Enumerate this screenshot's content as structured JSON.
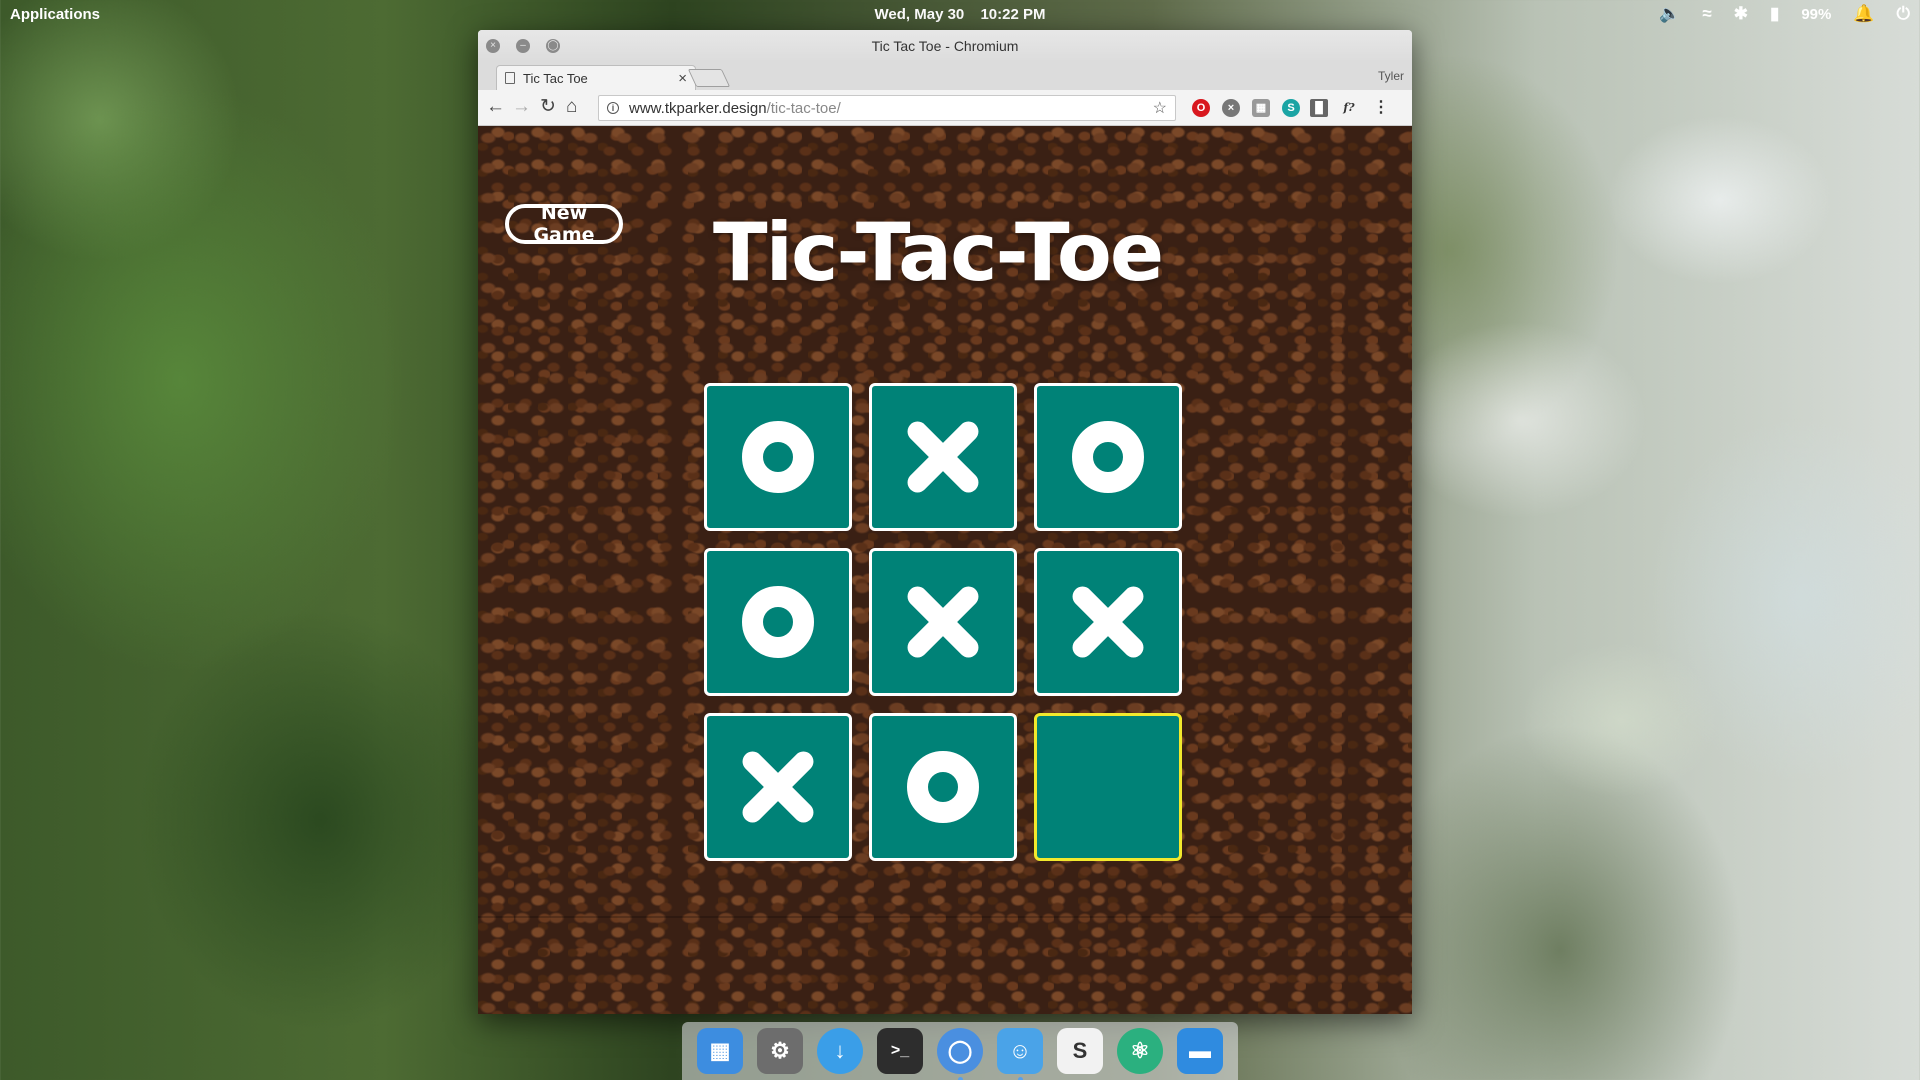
{
  "panel": {
    "applications_label": "Applications",
    "date": "Wed, May 30",
    "time": "10:22 PM",
    "battery_percent": "99%",
    "icons": [
      "volume-icon",
      "wifi-icon",
      "bluetooth-icon",
      "battery-icon",
      "notifications-icon",
      "power-icon"
    ]
  },
  "window": {
    "title": "Tic Tac Toe - Chromium",
    "tab_title": "Tic Tac Toe",
    "profile_name": "Tyler",
    "url_host": "www.tkparker.design",
    "url_path": "/tic-tac-toe/"
  },
  "game": {
    "new_game_label": "New Game",
    "title": "Tic-Tac-Toe",
    "board": [
      "O",
      "X",
      "O",
      "O",
      "X",
      "X",
      "X",
      "O",
      ""
    ],
    "highlighted_cell": 8,
    "colors": {
      "cell": "#008277",
      "highlight_border": "#f2e92d",
      "mark": "#ffffff"
    }
  },
  "dock": {
    "apps": [
      "multitasking-view",
      "system-settings",
      "appcenter",
      "terminal",
      "chromium",
      "files",
      "slack",
      "atom",
      "notes"
    ]
  }
}
